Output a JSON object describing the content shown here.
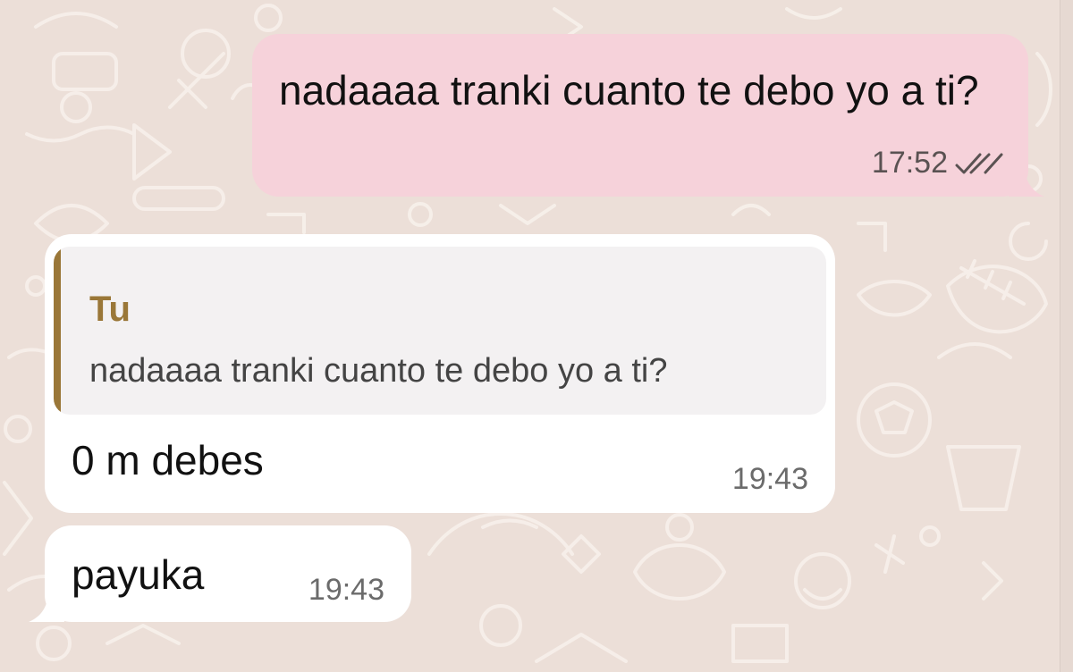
{
  "chat": {
    "messages": [
      {
        "direction": "outgoing",
        "text": "nadaaaa tranki cuanto te debo yo a ti?",
        "time": "17:52",
        "status": "read-double-check"
      },
      {
        "direction": "incoming",
        "reply_to": {
          "author": "Tu",
          "text": "nadaaaa tranki cuanto te debo yo a ti?"
        },
        "text": "0 m debes",
        "time": "19:43"
      },
      {
        "direction": "incoming",
        "text": "payuka",
        "time": "19:43"
      }
    ]
  },
  "colors": {
    "wallpaper": "#ecdfd8",
    "outgoing_bubble": "#f6d2da",
    "incoming_bubble": "#ffffff",
    "quote_background": "#f3f1f2",
    "quote_accent": "#9a7738"
  },
  "icons": {
    "status": "double-check-icon",
    "wallpaper": "doodle-pattern"
  }
}
